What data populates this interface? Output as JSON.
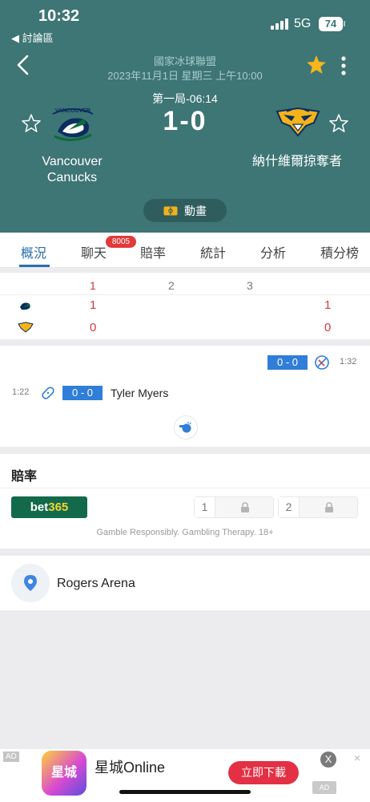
{
  "status_bar": {
    "time": "10:32",
    "back_app": "◀ 討論區",
    "network": "5G",
    "battery": "74"
  },
  "match": {
    "league": "國家冰球聯盟",
    "datetime": "2023年11月1日 星期三 上午10:00",
    "period_time": "第一局-06:14",
    "score": "1-0",
    "home": {
      "name_line1": "Vancouver",
      "name_line2": "Canucks",
      "logo": "canucks-logo"
    },
    "away": {
      "name": "納什維爾掠奪者",
      "logo": "predators-logo"
    },
    "animation_label": "動畫"
  },
  "tabs": [
    {
      "label": "概況",
      "active": true
    },
    {
      "label": "聊天",
      "badge": "8005"
    },
    {
      "label": "賠率"
    },
    {
      "label": "統計"
    },
    {
      "label": "分析"
    },
    {
      "label": "積分榜"
    }
  ],
  "box_score": {
    "periods": [
      "1",
      "2",
      "3"
    ],
    "rows": [
      {
        "team": "canucks-logo",
        "p1": "1",
        "total": "1"
      },
      {
        "team": "predators-logo",
        "p1": "0",
        "total": "0"
      }
    ]
  },
  "events": [
    {
      "time": "1:32",
      "score": "0 - 0",
      "side": "away",
      "icon": "no-goal-icon"
    },
    {
      "time": "1:22",
      "score": "0 - 0",
      "side": "home",
      "player": "Tyler Myers",
      "icon": "bandage-icon"
    }
  ],
  "odds": {
    "title": "賠率",
    "bookmaker_main": "bet",
    "bookmaker_accent": "365",
    "option1": "1",
    "option2": "2",
    "disclaimer": "Gamble Responsibly. Gambling Therapy. 18+"
  },
  "venue": {
    "name": "Rogers Arena"
  },
  "ad": {
    "tag": "AD",
    "icon_text": "星城",
    "name": "星城Online",
    "cta": "立即下載",
    "close": "X",
    "dismiss": "×",
    "badge": "AD"
  },
  "colors": {
    "header_bg": "#3e7575",
    "accent_blue": "#2f7ed8",
    "score_red": "#d23a3a",
    "star_gold": "#f5b61e"
  }
}
